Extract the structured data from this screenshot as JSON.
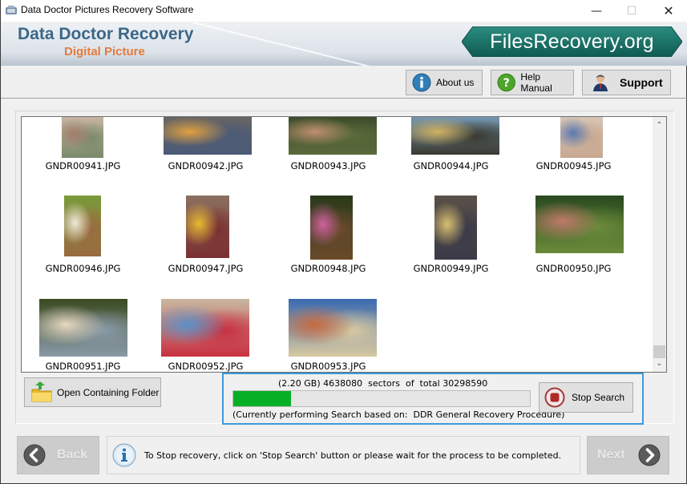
{
  "window": {
    "title": "Data Doctor Pictures Recovery Software",
    "controls": {
      "minimize": "—",
      "maximize": "☐",
      "close": "✕"
    }
  },
  "banner": {
    "brand_line1": "Data Doctor Recovery",
    "brand_line2": "Digital Picture",
    "site_badge": "FilesRecovery.org",
    "colors": {
      "brand1": "#3b6788",
      "brand2": "#e47a3e",
      "badge": "#1f7a6e"
    }
  },
  "toolbar": {
    "about_label": "About us",
    "help_label": "Help Manual",
    "support_label": "Support"
  },
  "files": [
    {
      "name": "GNDR00941.JPG",
      "orientation": "portrait",
      "palette": [
        "#c9b6a4",
        "#a07c6a",
        "#7a8a6a"
      ]
    },
    {
      "name": "GNDR00942.JPG",
      "orientation": "landscape",
      "palette": [
        "#6c6660",
        "#e0a040",
        "#4a5a78"
      ]
    },
    {
      "name": "GNDR00943.JPG",
      "orientation": "landscape",
      "palette": [
        "#3a4a2a",
        "#c09070",
        "#5a6a3a"
      ]
    },
    {
      "name": "GNDR00944.JPG",
      "orientation": "landscape",
      "palette": [
        "#7aa0c0",
        "#d0b060",
        "#3a3a30"
      ]
    },
    {
      "name": "GNDR00945.JPG",
      "orientation": "portrait",
      "palette": [
        "#d8c8b8",
        "#5a78b0",
        "#c8a890"
      ]
    },
    {
      "name": "GNDR00946.JPG",
      "orientation": "portrait",
      "palette": [
        "#7a9a3a",
        "#f0e8d8",
        "#9a6a40"
      ]
    },
    {
      "name": "GNDR00947.JPG",
      "orientation": "portrait",
      "palette": [
        "#8a7060",
        "#e8b830",
        "#7a3030"
      ]
    },
    {
      "name": "GNDR00948.JPG",
      "orientation": "portrait",
      "palette": [
        "#2a3a1a",
        "#d060a0",
        "#6a4a2a"
      ]
    },
    {
      "name": "GNDR00949.JPG",
      "orientation": "portrait",
      "palette": [
        "#5a5048",
        "#d8c070",
        "#3a3a48"
      ]
    },
    {
      "name": "GNDR00950.JPG",
      "orientation": "landscape",
      "palette": [
        "#2a4a20",
        "#c07a6a",
        "#6a8a3a"
      ]
    },
    {
      "name": "GNDR00951.JPG",
      "orientation": "landscape",
      "palette": [
        "#3a4a20",
        "#e8d8c0",
        "#8a9aa8"
      ]
    },
    {
      "name": "GNDR00952.JPG",
      "orientation": "landscape",
      "palette": [
        "#c8b8a0",
        "#5a90c8",
        "#c83040"
      ]
    },
    {
      "name": "GNDR00953.JPG",
      "orientation": "landscape",
      "palette": [
        "#3a6ab0",
        "#c86a40",
        "#d8c8a0"
      ]
    }
  ],
  "scrollbar": {
    "up": "⌃",
    "down": "⌄"
  },
  "open_folder_label": "Open Containing Folder",
  "progress": {
    "info_text": "(2.20 GB) 4638080  sectors  of  total 30298590",
    "sectors_done": 4638080,
    "sectors_total": 30298590,
    "fraction": 0.195,
    "procedure_text": "(Currently performing Search based on:  DDR General Recovery Procedure)",
    "stop_label": "Stop Search",
    "bar_color": "#06b025"
  },
  "footer": {
    "back_label": "Back",
    "next_label": "Next",
    "status_message": "To Stop recovery, click on 'Stop Search' button or please wait for the process to be completed."
  }
}
